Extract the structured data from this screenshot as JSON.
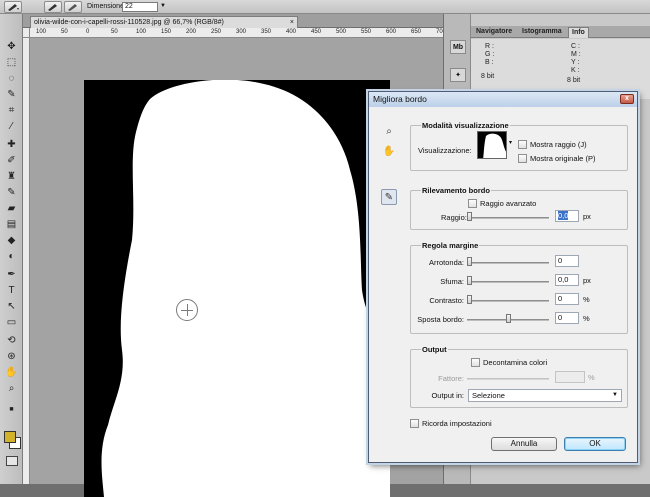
{
  "options_bar": {
    "dimension_label": "Dimensione:",
    "dimension_value": "22"
  },
  "document": {
    "tab_title": "olivia-wilde-con-i-capelli-rossi-110528.jpg @ 66,7% (RGB/8#)",
    "close_glyph": "×"
  },
  "ruler": {
    "top_ticks": [
      "100",
      "50",
      "0",
      "50",
      "100",
      "150",
      "200",
      "250",
      "300",
      "350",
      "400",
      "450",
      "500",
      "550",
      "600",
      "650",
      "700"
    ]
  },
  "colors": {
    "foreground": "#d3b22b",
    "background": "#ffffff"
  },
  "panel": {
    "tabs": [
      "Navigatore",
      "Istogramma",
      "Info"
    ],
    "active_tab": "Info",
    "info_left": [
      "R :",
      "G :",
      "B :",
      "8 bit"
    ],
    "info_right": [
      "C :",
      "M :",
      "Y :",
      "K :",
      "8 bit"
    ]
  },
  "dialog": {
    "title": "Migliora bordo",
    "close_glyph": "x",
    "view_mode": {
      "title": "Modalità visualizzazione",
      "view_label": "Visualizzazione:",
      "show_radius": "Mostra raggio (J)",
      "show_original": "Mostra originale (P)"
    },
    "edge_detection": {
      "title": "Rilevamento bordo",
      "smart_radius": "Raggio avanzato",
      "radius_label": "Raggio:",
      "radius_value": "0,0",
      "radius_unit": "px"
    },
    "adjust_edge": {
      "title": "Regola margine",
      "smooth_label": "Arrotonda:",
      "smooth_value": "0",
      "feather_label": "Sfuma:",
      "feather_value": "0,0",
      "feather_unit": "px",
      "contrast_label": "Contrasto:",
      "contrast_value": "0",
      "contrast_unit": "%",
      "shift_label": "Sposta bordo:",
      "shift_value": "0",
      "shift_unit": "%"
    },
    "output": {
      "title": "Output",
      "decontaminate": "Decontamina colori",
      "amount_label": "Fattore:",
      "amount_unit": "%",
      "output_to_label": "Output in:",
      "output_to_value": "Selezione"
    },
    "remember": "Ricorda impostazioni",
    "cancel_label": "Annulla",
    "ok_label": "OK"
  }
}
